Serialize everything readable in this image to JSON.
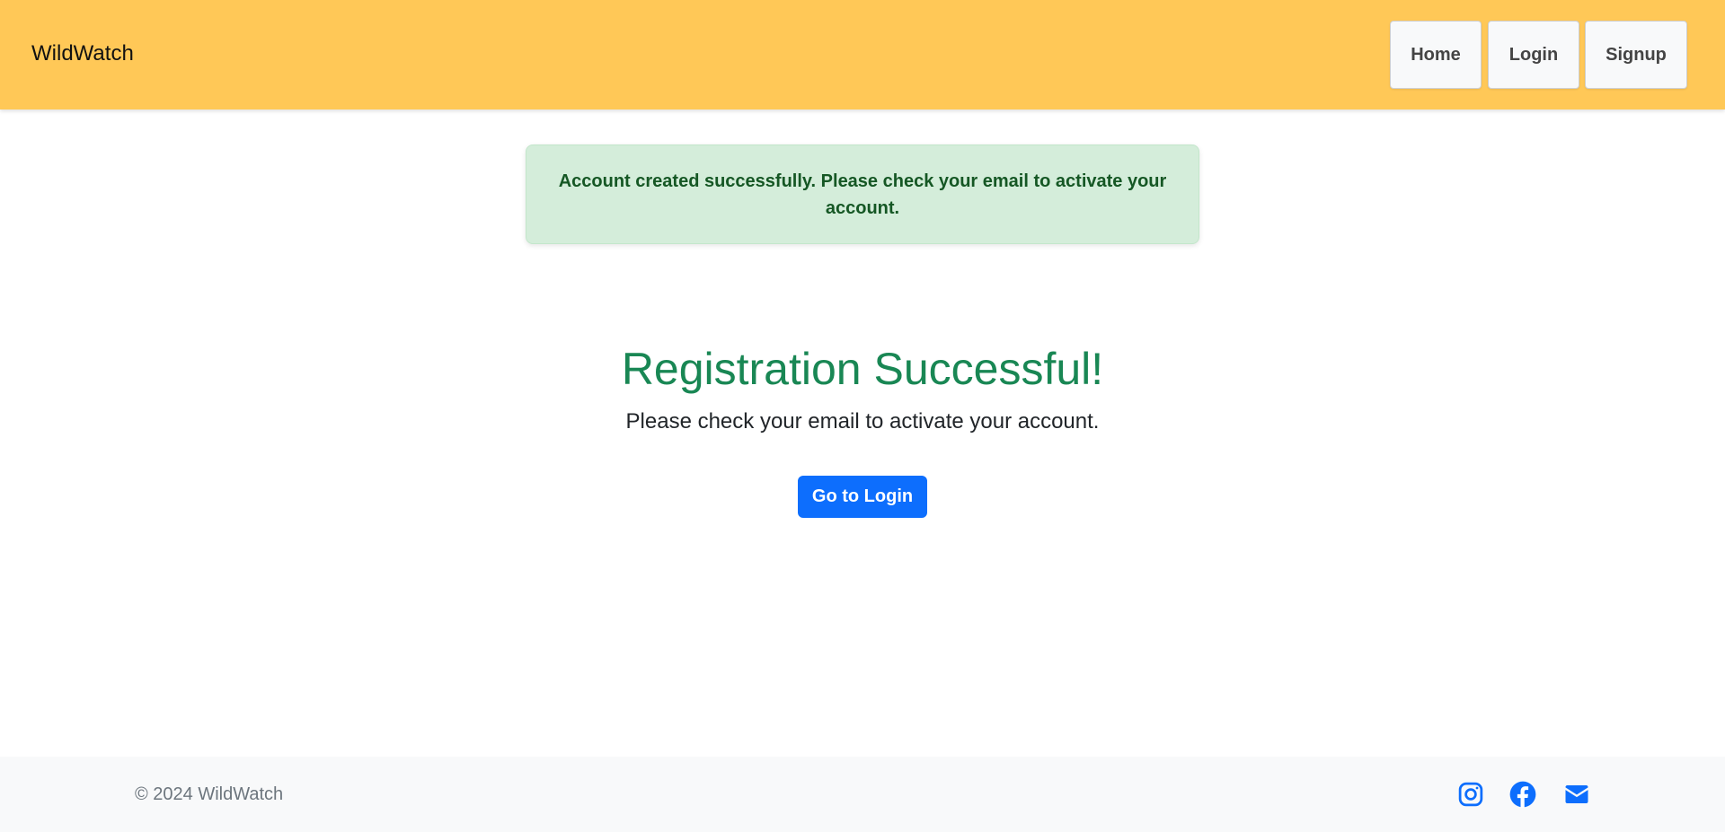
{
  "navbar": {
    "brand": "WildWatch",
    "links": [
      {
        "label": "Home"
      },
      {
        "label": "Login"
      },
      {
        "label": "Signup"
      }
    ]
  },
  "alert": {
    "message": "Account created successfully. Please check your email to activate your account."
  },
  "main": {
    "title": "Registration Successful!",
    "subtitle": "Please check your email to activate your account.",
    "button_label": "Go to Login"
  },
  "footer": {
    "copyright": "© 2024 WildWatch",
    "social_icons": [
      "instagram-icon",
      "facebook-icon",
      "email-icon"
    ]
  },
  "colors": {
    "navbar_bg": "#ffc857",
    "alert_bg": "#d4edda",
    "alert_text": "#155724",
    "title_green": "#198754",
    "primary_blue": "#0d6efd",
    "footer_bg": "#f8f9fa"
  }
}
